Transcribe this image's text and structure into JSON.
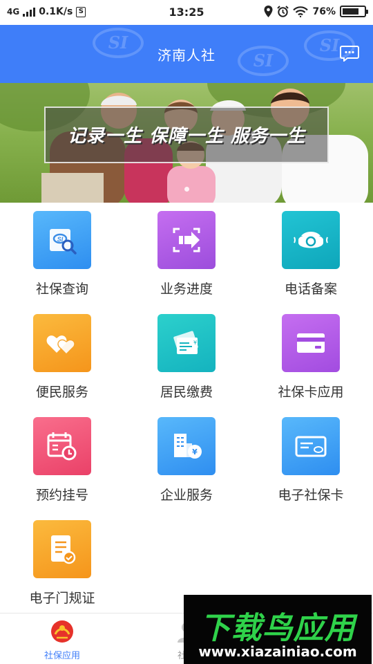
{
  "status_bar": {
    "network": "4G",
    "speed": "0.1K/s",
    "time": "13:25",
    "battery": "76%",
    "battery_level": 0.76
  },
  "header": {
    "title": "济南人社",
    "watermark_text": "SI"
  },
  "banner": {
    "slogan": "记录一生 保障一生 服务一生"
  },
  "services": [
    {
      "label": "社保查询",
      "icon": "search-card-icon",
      "color": "#3aa2f2"
    },
    {
      "label": "业务进度",
      "icon": "progress-icon",
      "color": "#b05ee6"
    },
    {
      "label": "电话备案",
      "icon": "telephone-icon",
      "color": "#14b6c8"
    },
    {
      "label": "便民服务",
      "icon": "hearts-icon",
      "color": "#f9a52a"
    },
    {
      "label": "居民缴费",
      "icon": "payment-icon",
      "color": "#1fc2c9"
    },
    {
      "label": "社保卡应用",
      "icon": "card-icon",
      "color": "#b65be6"
    },
    {
      "label": "预约挂号",
      "icon": "calendar-clock-icon",
      "color": "#f05579"
    },
    {
      "label": "企业服务",
      "icon": "building-yuan-icon",
      "color": "#3b9af2"
    },
    {
      "label": "电子社保卡",
      "icon": "e-card-icon",
      "color": "#3aa2f2"
    },
    {
      "label": "电子门规证",
      "icon": "document-check-icon",
      "color": "#f9a52a"
    }
  ],
  "tabs": [
    {
      "label": "社保应用",
      "active": true
    },
    {
      "label": "社保",
      "active": false
    }
  ],
  "ad": {
    "title": "下载鸟应用",
    "url": "www.xiazainiao.com"
  },
  "colors": {
    "header": "#3f7ef9",
    "tab_active": "#3f7ef9"
  }
}
